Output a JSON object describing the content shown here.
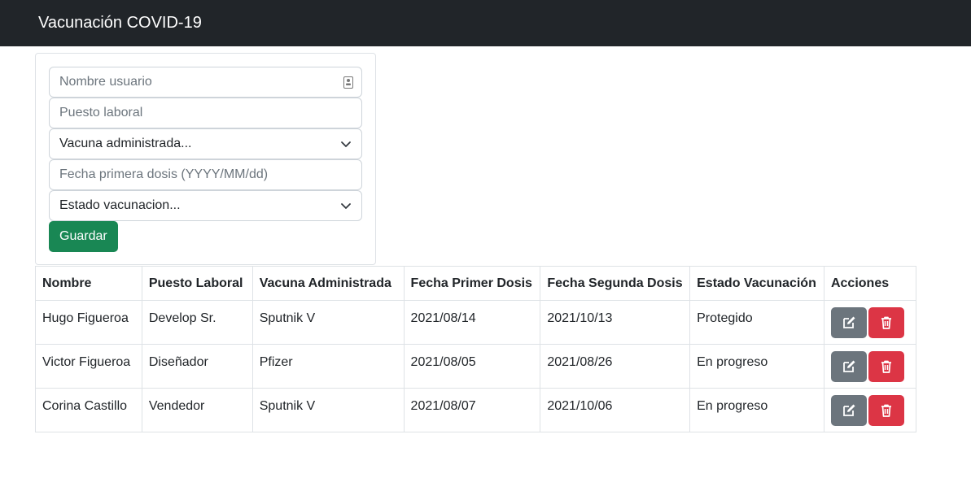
{
  "navbar": {
    "brand": "Vacunación COVID-19"
  },
  "form": {
    "name_placeholder": "Nombre usuario",
    "job_placeholder": "Puesto laboral",
    "vaccine_select": "Vacuna administrada...",
    "date_placeholder": "Fecha primera dosis (YYYY/MM/dd)",
    "status_select": "Estado vacunacion...",
    "save_label": "Guardar"
  },
  "table": {
    "headers": [
      "Nombre",
      "Puesto Laboral",
      "Vacuna Administrada",
      "Fecha Primer Dosis",
      "Fecha Segunda Dosis",
      "Estado Vacunación",
      "Acciones"
    ],
    "rows": [
      [
        "Hugo Figueroa",
        "Develop Sr.",
        "Sputnik V",
        "2021/08/14",
        "2021/10/13",
        "Protegido"
      ],
      [
        "Victor Figueroa",
        "Diseñador",
        "Pfizer",
        "2021/08/05",
        "2021/08/26",
        "En progreso"
      ],
      [
        "Corina Castillo",
        "Vendedor",
        "Sputnik V",
        "2021/08/07",
        "2021/10/06",
        "En progreso"
      ]
    ]
  },
  "icons": {
    "edit": "edit-icon",
    "delete": "trash-icon",
    "select": "chevron-down-icon",
    "contact": "contact-card-icon"
  },
  "colors": {
    "navbar": "#212529",
    "save": "#198754",
    "edit": "#6c757d",
    "delete": "#dc3545"
  }
}
